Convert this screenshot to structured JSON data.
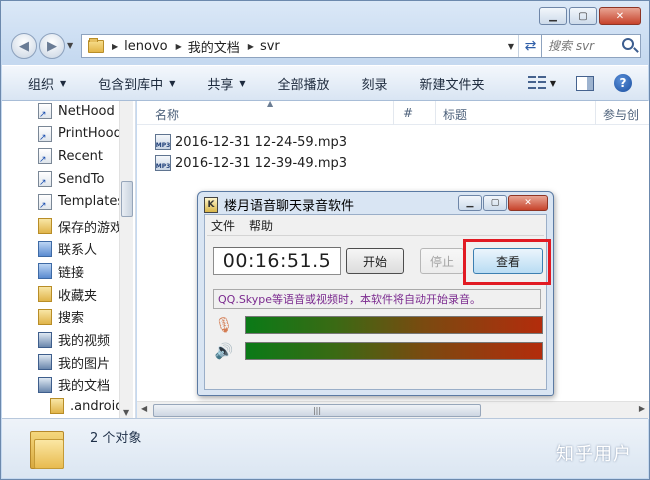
{
  "explorer": {
    "caption": {
      "minimize": "▁",
      "maximize": "▢",
      "close": "✕"
    },
    "breadcrumbs": [
      "lenovo",
      "我的文档",
      "svr"
    ],
    "search": {
      "placeholder": "搜索 svr"
    },
    "toolbar": {
      "organize": "组织",
      "include_in_library": "包含到库中",
      "share": "共享",
      "burn": "全部播放",
      "record": "刻录",
      "new_folder": "新建文件夹"
    },
    "nav_items": [
      {
        "label": "NetHood",
        "icon": "shortcut-icon"
      },
      {
        "label": "PrintHood",
        "icon": "shortcut-icon"
      },
      {
        "label": "Recent",
        "icon": "shortcut-icon"
      },
      {
        "label": "SendTo",
        "icon": "shortcut-icon"
      },
      {
        "label": "Templates",
        "icon": "shortcut-icon"
      },
      {
        "label": "保存的游戏",
        "icon": "saved-games-icon"
      },
      {
        "label": "联系人",
        "icon": "contacts-icon"
      },
      {
        "label": "链接",
        "icon": "links-icon"
      },
      {
        "label": "收藏夹",
        "icon": "favorites-icon"
      },
      {
        "label": "搜索",
        "icon": "searches-icon"
      },
      {
        "label": "我的视频",
        "icon": "videos-icon"
      },
      {
        "label": "我的图片",
        "icon": "pictures-icon"
      },
      {
        "label": "我的文档",
        "icon": "documents-icon"
      },
      {
        "label": ".android",
        "icon": "folder-icon"
      }
    ],
    "columns": [
      "名称",
      "#",
      "标题",
      "参与创"
    ],
    "files": [
      {
        "name": "2016-12-31 12-24-59.mp3"
      },
      {
        "name": "2016-12-31 12-39-49.mp3"
      }
    ],
    "status": {
      "item_count": "2 个对象"
    },
    "watermark": "知乎用户"
  },
  "recorder": {
    "title": "楼月语音聊天录音软件",
    "caption": {
      "minimize": "▁",
      "maximize": "▢",
      "close": "✕"
    },
    "menu": [
      "文件",
      "帮助"
    ],
    "timer": "00:16:51.5",
    "start_label": "开始",
    "stop_label": "停止",
    "view_label": "查看",
    "hint": "QQ.Skype等语音或视频时，本软件将自动开始录音。",
    "colors": {
      "highlight": "#e11a23",
      "hint_text": "#7b2a8f"
    }
  }
}
